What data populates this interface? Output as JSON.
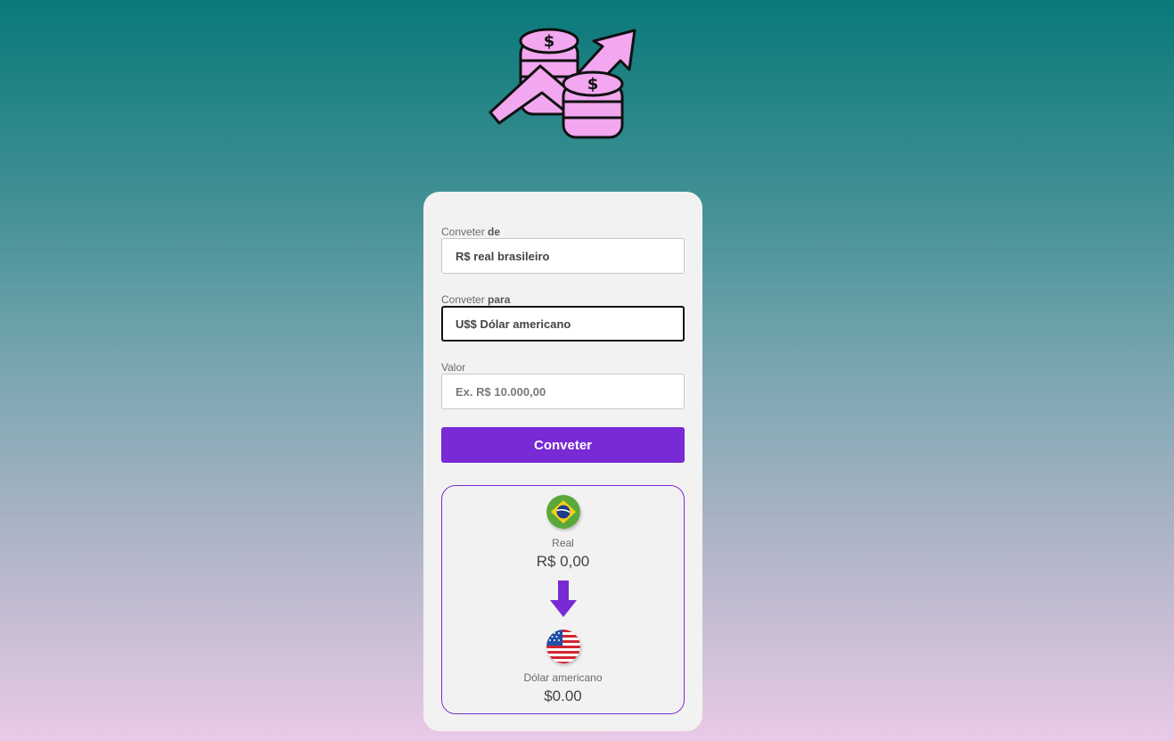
{
  "form": {
    "from_label": "Conveter",
    "from_label_bold": "de",
    "from_selected": "R$ real brasileiro",
    "to_label": "Conveter",
    "to_label_bold": "para",
    "to_selected": "U$$ Dólar americano",
    "value_label": "Valor",
    "value_placeholder": "Ex. R$ 10.000,00",
    "value_current": "",
    "convert_button": "Conveter"
  },
  "result": {
    "from_currency_name": "Real",
    "from_currency_value": "R$ 0,00",
    "to_currency_name": "Dólar americano",
    "to_currency_value": "$0.00"
  },
  "icons": {
    "logo": "coins-growth-logo",
    "from_flag": "brazil-flag-icon",
    "arrow": "arrow-down-icon",
    "to_flag": "usa-flag-icon"
  },
  "colors": {
    "accent": "#782ad4",
    "logo_pink": "#f2a7f0",
    "gradient_top": "#09797a",
    "gradient_bottom": "#e9cae6"
  }
}
